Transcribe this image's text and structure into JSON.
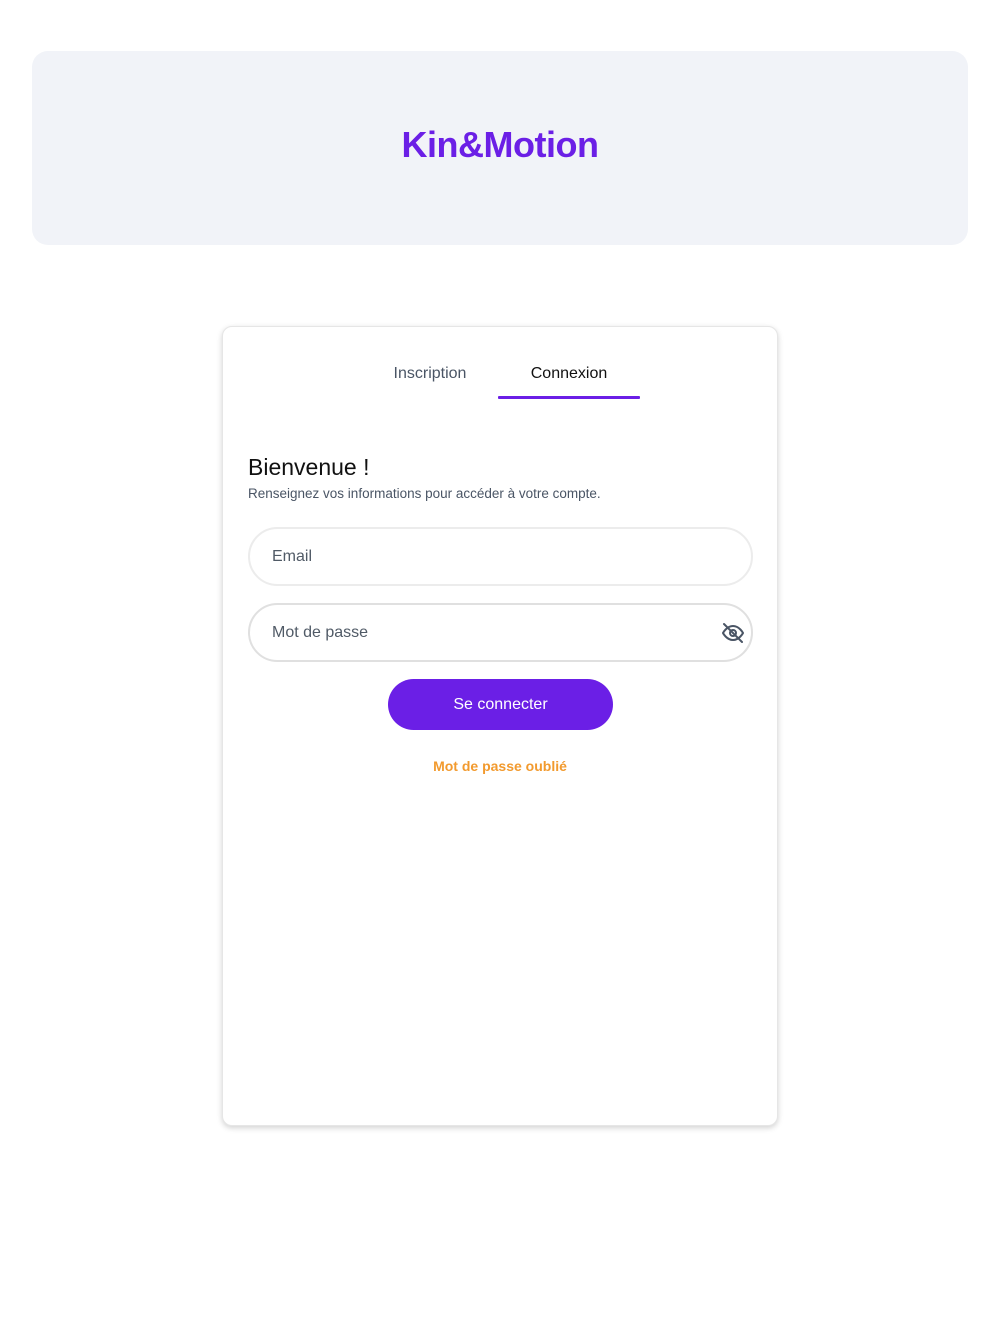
{
  "header": {
    "brand": "Kin&Motion",
    "brand_color": "#6b1fe6",
    "background_color": "#f1f3f8"
  },
  "auth_card": {
    "tabs": [
      {
        "label": "Inscription",
        "active": false
      },
      {
        "label": "Connexion",
        "active": true
      }
    ],
    "title": "Bienvenue !",
    "subtitle": "Renseignez vos informations pour accéder à votre compte.",
    "email_field": {
      "placeholder": "Email",
      "value": ""
    },
    "password_field": {
      "placeholder": "Mot de passe",
      "value": "",
      "toggle_icon": "eye-off-icon"
    },
    "submit_label": "Se connecter",
    "submit_color": "#6b1fe6",
    "forgot_password_label": "Mot de passe oublié",
    "forgot_password_color": "#f29a2e"
  }
}
